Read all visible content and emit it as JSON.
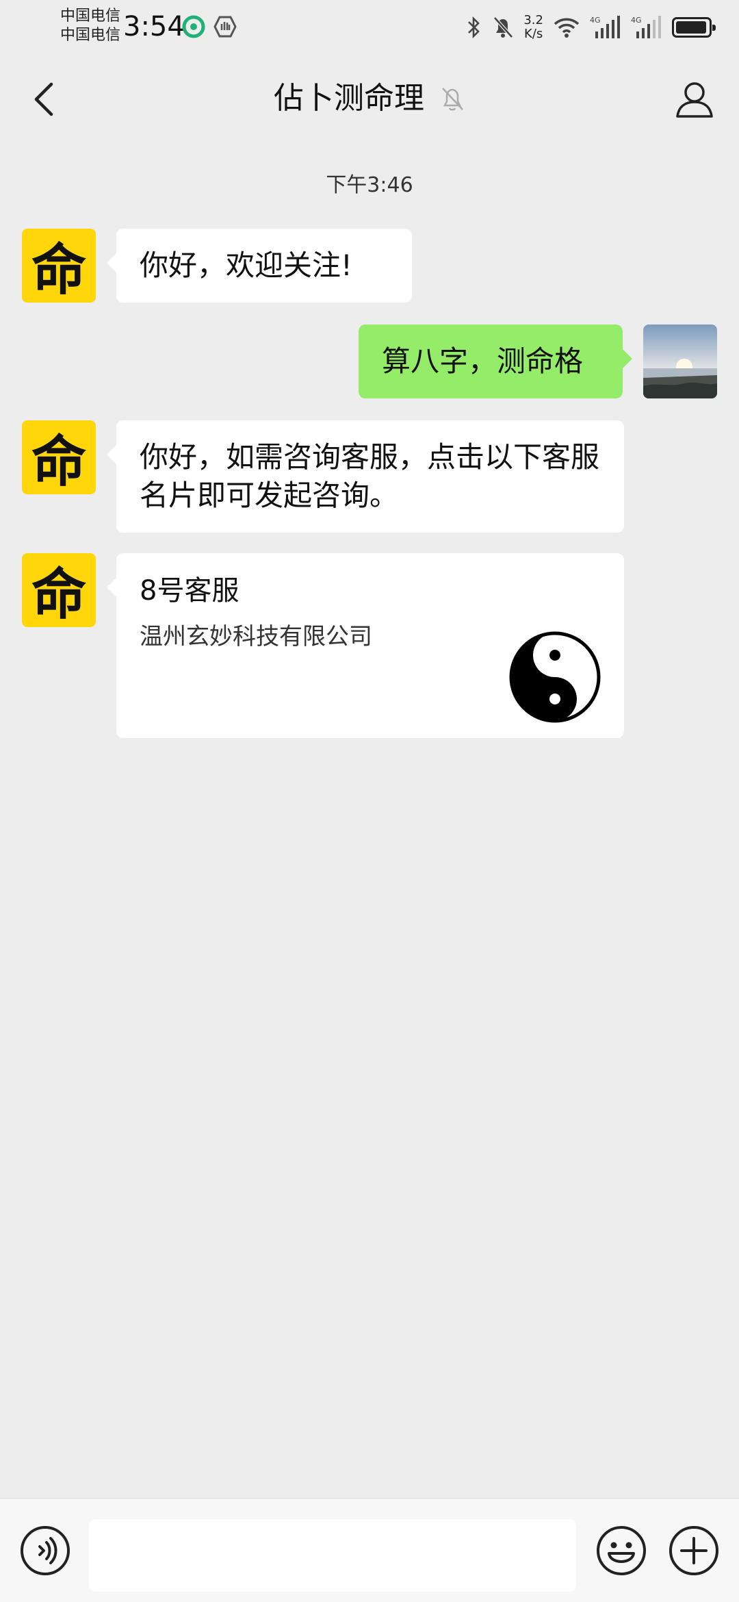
{
  "status_bar": {
    "carrier_1": "中国电信",
    "carrier_2": "中国电信",
    "time": "3:54",
    "speed_value": "3.2",
    "speed_unit": "K/s",
    "network_label_1": "4G",
    "network_label_2": "4G"
  },
  "header": {
    "title": "佔卜测命理"
  },
  "chat": {
    "timestamp": "下午3:46",
    "avatar_char": "命",
    "messages": [
      {
        "text": "你好，欢迎关注!"
      },
      {
        "text": "算八字，测命格"
      },
      {
        "text": "你好，如需咨询客服，点击以下客服名片即可发起咨询。"
      }
    ],
    "contact_card": {
      "name": "8号客服",
      "company": "温州玄妙科技有限公司"
    }
  },
  "input_bar": {
    "text_value": ""
  },
  "icons": {
    "back": "chevron-left-icon",
    "mute": "bell-off-icon",
    "profile": "person-icon",
    "voice": "voice-icon",
    "emoji": "emoji-icon",
    "plus": "plus-icon",
    "card_logo": "yin-yang-icon"
  },
  "colors": {
    "background": "#ededed",
    "sent_bubble": "#95ec69",
    "received_bubble": "#ffffff",
    "bot_avatar": "#fed60a"
  }
}
